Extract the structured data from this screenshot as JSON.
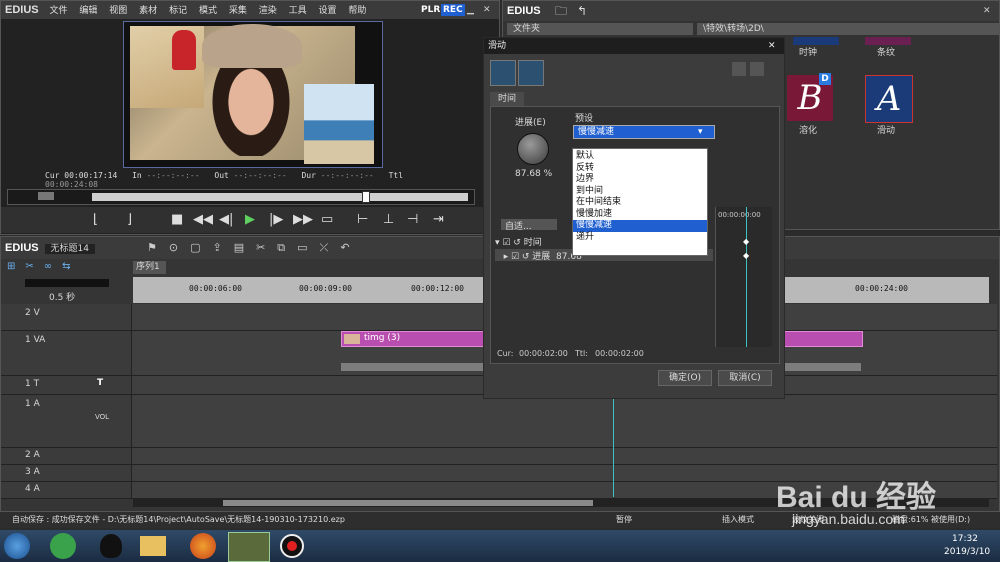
{
  "app": {
    "logo": "EDIUS",
    "menu": [
      "文件",
      "编辑",
      "视图",
      "素材",
      "标记",
      "模式",
      "采集",
      "渲染",
      "工具",
      "设置",
      "帮助"
    ],
    "plr": "PLR",
    "rec": "REC"
  },
  "player": {
    "cur_label": "Cur",
    "cur": "00:00:17:14",
    "in_label": "In",
    "in": "--:--:--:--",
    "out_label": "Out",
    "out": "--:--:--:--",
    "dur_label": "Dur",
    "dur": "--:--:--:--",
    "ttl_label": "Ttl",
    "ttl": "00:00:24:08"
  },
  "effects_panel": {
    "logo": "EDIUS",
    "folder_col": "文件夹",
    "path": "\\特效\\转场\\2D\\",
    "items": [
      {
        "label": "时钟"
      },
      {
        "label": "条纹"
      },
      {
        "label": "溶化",
        "glyph": "B"
      },
      {
        "label": "滑动",
        "glyph": "A"
      }
    ]
  },
  "timeline": {
    "logo": "EDIUS",
    "project": "无标题14",
    "sequence_tab": "序列1",
    "zoom": "0.5 秒",
    "ruler": [
      "00:00:06:00",
      "00:00:09:00",
      "00:00:12:00",
      "00:00:24:00"
    ],
    "tracks": [
      {
        "name": "2 V"
      },
      {
        "name": "1 VA"
      },
      {
        "name": "1 T"
      },
      {
        "name": "1 A",
        "vol": "VOL"
      },
      {
        "name": "2 A"
      },
      {
        "name": "3 A"
      },
      {
        "name": "4 A"
      }
    ],
    "clip_label": "timg (3)"
  },
  "dialog": {
    "title": "滑动",
    "tab": "时间",
    "progress_label": "进展(E)",
    "progress_value": "87.68 %",
    "preset_label": "预设",
    "preset_selected": "慢慢减速",
    "preset_options": [
      "默认",
      "反转",
      "边界",
      "到中间",
      "在中间结束",
      "慢慢加速",
      "慢慢减速",
      "递升"
    ],
    "auto_label": "自适...",
    "tree_time": "时间",
    "tree_progress": "进展",
    "tree_progress_value": "87.68",
    "kf_time": "00:00:00:00",
    "cur_label": "Cur:",
    "cur": "00:00:02:00",
    "ttl_label": "Ttl:",
    "ttl": "00:00:02:00",
    "ok": "确定(O)",
    "cancel": "取消(C)"
  },
  "status": {
    "autosave": "自动保存 : 成功保存文件 - D:\\无标题14\\Project\\AutoSave\\无标题14-190310-173210.ezp",
    "pause": "暂停",
    "insert_mode": "插入模式",
    "ripple": "波纹关闭",
    "disk": "磁盘:61% 被使用(D:)"
  },
  "taskbar": {
    "time": "17:32",
    "date": "2019/3/10"
  },
  "watermark": {
    "brand": "Bai du 经验",
    "url": "jingyan.baidu.com"
  },
  "colors": {
    "accent": "#1f5fd0",
    "clip": "#b84fb0",
    "rec": "#1f5fd0"
  }
}
